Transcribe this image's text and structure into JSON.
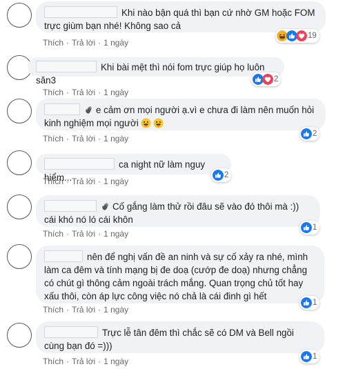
{
  "actions": {
    "like": "Thích",
    "reply": "Trả lời",
    "sep": "·",
    "time": "1 ngày"
  },
  "comments": [
    {
      "text": "Khi nào bận quá thì bạn cứ nhờ GM hoặc FOM trực giùm bạn nhé! Không sao cả",
      "reactions": [
        "haha",
        "like",
        "love"
      ],
      "count": "19"
    },
    {
      "text": "Khi bài mệt thì nói fom trực giúp họ luôn săn3",
      "reactions": [
        "like",
        "love"
      ],
      "count": "2"
    },
    {
      "text": "e cảm ơn mọi người ạ.vì e chưa đi làm nên muốn hỏi kinh nghiệm mọi người",
      "reactions": [
        "like"
      ],
      "count": "2"
    },
    {
      "text": "ca night nữ làm nguy hiểm...",
      "reactions": [
        "like"
      ],
      "count": "2"
    },
    {
      "text": "Cố gắng làm thử rồi đâu sẽ vào đó thôi mà :)) cái khó nó ló cái khôn",
      "reactions": [
        "like"
      ],
      "count": "1"
    },
    {
      "text": "nên để nghị vấn đề an ninh và sự cố xảy ra nhé, mình làm ca đêm và tính mạng bị đe doạ (cướp đe doạ) nhưng chẳng có chút gì thông cảm ngoài trách mắng. Quan trọng chủ tốt hay xấu thôi, còn áp lực công việc nó chả là cái đinh gì hết",
      "reactions": [
        "like"
      ],
      "count": "1"
    },
    {
      "text": "Trực lễ tân đêm thì chắc sẽ có DM và Bell ngồi cùng bạn đó =)))",
      "reactions": [
        "like"
      ],
      "count": "1"
    }
  ],
  "colors": {
    "bubble": "#f0f2f5",
    "like": "#1877f2",
    "love": "#f33e58",
    "haha": "#f7b125",
    "meta": "#65676b"
  }
}
